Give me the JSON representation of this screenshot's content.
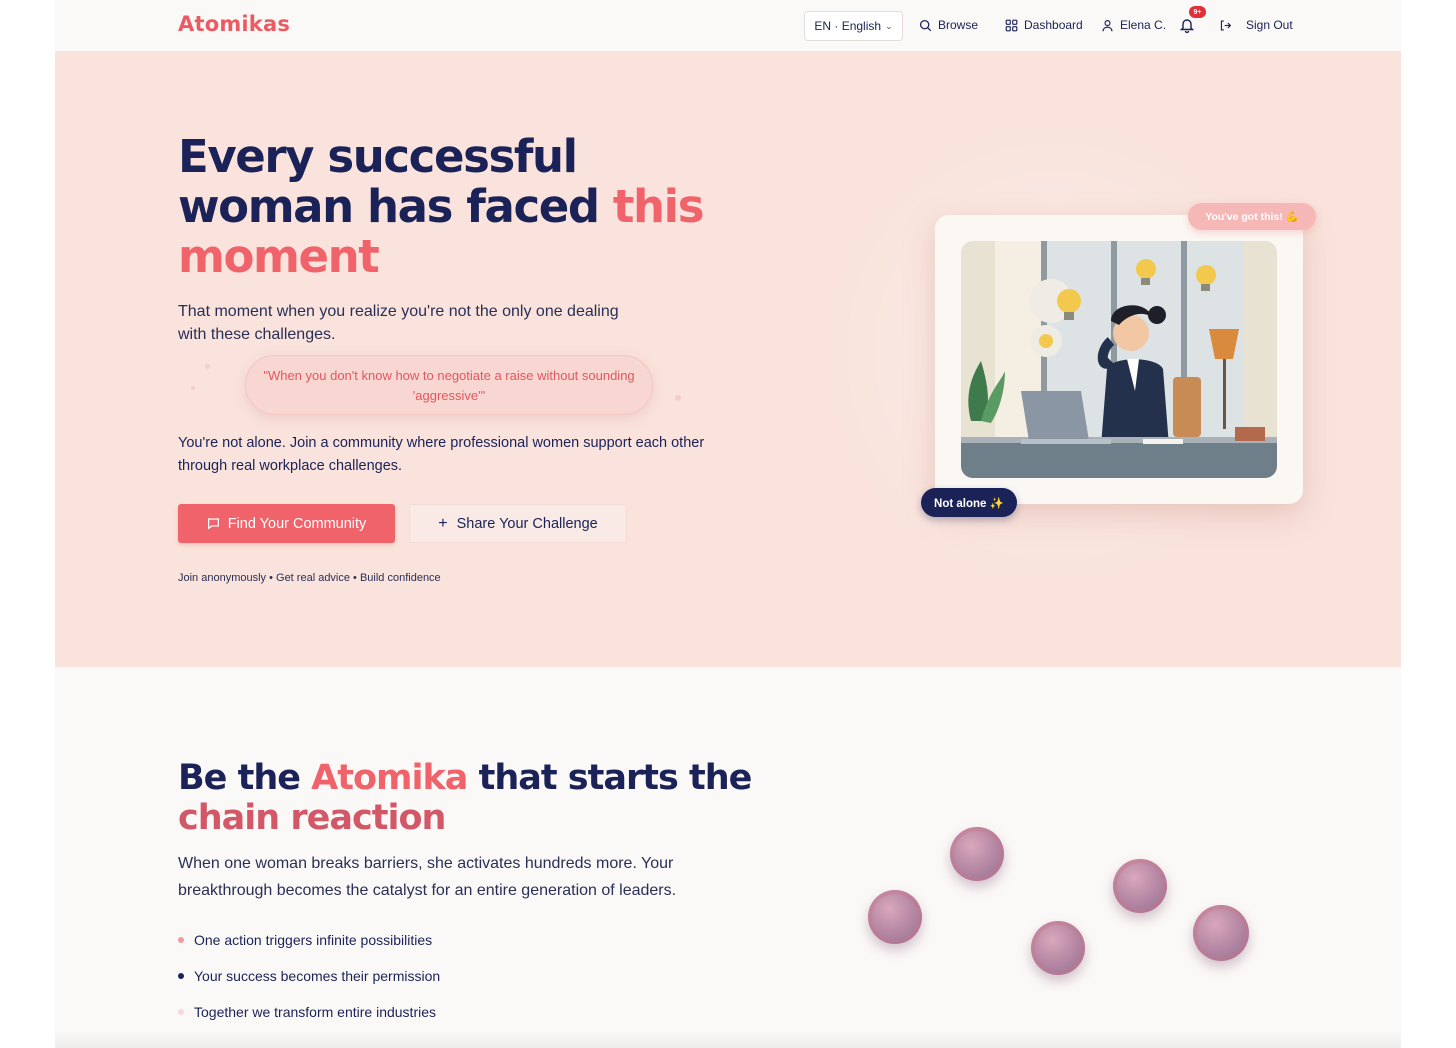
{
  "nav": {
    "logo": "Atomikas",
    "language": "EN · English",
    "browse": "Browse",
    "dashboard": "Dashboard",
    "user": "Elena C.",
    "notifications_badge": "9+",
    "signout": "Sign Out"
  },
  "hero": {
    "headline_part1": "Every successful woman has faced ",
    "headline_accent": "this moment",
    "subtitle": "That moment when you realize you're not the only one dealing with these challenges.",
    "quote": "\"When you don't know how to negotiate a raise without sounding 'aggressive'\"",
    "body": "You're not alone. Join a community where professional women support each other through real workplace challenges.",
    "primary_button": "Find Your Community",
    "secondary_button": "Share Your Challenge",
    "tagline": "Join anonymously • Get real advice • Build confidence",
    "pill_top": "You've got this! 💪",
    "pill_bottom": "Not alone ✨"
  },
  "section2": {
    "title_part1": "Be the ",
    "title_accent": "Atomika",
    "title_part2": " that starts the ",
    "title_gradient": "chain reaction",
    "body": "When one woman breaks barriers, she activates hundreds more. Your breakthrough becomes the catalyst for an entire generation of leaders.",
    "bullets": [
      {
        "text": "One action triggers infinite possibilities",
        "color": "#f39aa0"
      },
      {
        "text": "Your success becomes their permission",
        "color": "#1a2257"
      },
      {
        "text": "Together we transform entire industries",
        "color": "#f8d9d8"
      }
    ]
  },
  "colors": {
    "brand": "#f0636b",
    "navy": "#1a2257",
    "hero_bg": "#f9e3dc"
  }
}
